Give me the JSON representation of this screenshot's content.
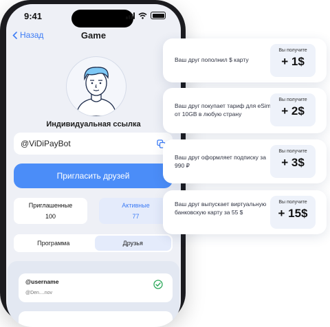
{
  "status": {
    "time": "9:41"
  },
  "nav": {
    "back_label": "Назад",
    "title": "Game"
  },
  "referral": {
    "label": "Индивидуальная ссылка",
    "link": "@ViDiPayBot"
  },
  "invite_button": "Пригласить друзей",
  "stats": {
    "invited": {
      "label": "Приглашенные",
      "value": "100"
    },
    "active": {
      "label": "Активные",
      "value": "77"
    }
  },
  "tabs": {
    "program": "Программа",
    "friends": "Друзья"
  },
  "friends": [
    {
      "username": "@username",
      "subtitle": "@Den....nov"
    }
  ],
  "colors": {
    "accent": "#4b8df8",
    "success": "#2ca85a"
  },
  "rewards": [
    {
      "desc": "Ваш друг пополнил $ карту",
      "label": "Вы получите",
      "amount": "+ 1$"
    },
    {
      "desc": "Ваш друг покупает тариф для eSim от 10GB в любую страну",
      "label": "Вы получите",
      "amount": "+ 2$"
    },
    {
      "desc": "Ваш друг оформляет подписку за 990 ₽",
      "label": "Вы получите",
      "amount": "+ 3$"
    },
    {
      "desc": "Ваш друг выпускает виртуальную банковскую карту за 55 $",
      "label": "Вы получите",
      "amount": "+ 15$"
    }
  ]
}
